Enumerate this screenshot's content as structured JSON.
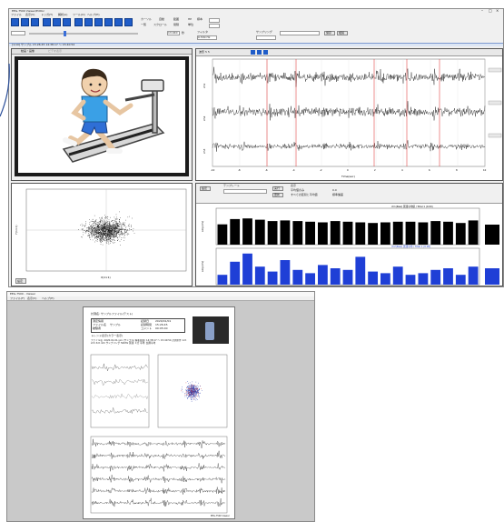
{
  "main_window": {
    "title": "EEG-7500 Viewer/Editor",
    "menu": [
      "ファイル",
      "表示(V)",
      "トリガ(T)",
      "解析(A)",
      "ツール(O)",
      "ヘルプ(H)"
    ],
    "toolbar": {
      "cursor": "カーソル",
      "auto": "自動",
      "range": "範囲",
      "list": "一覧",
      "scroll": "スクロール",
      "interval": "間隔",
      "unit": "単位",
      "filter": "フィルタ",
      "rate": "サンプリング",
      "time_value": "13.040",
      "time_label": "秒",
      "filter_value": "0.530 Hz",
      "hp_label": "HP",
      "sample_label": "標本",
      "save": "保存",
      "copy": "複製"
    },
    "status_strip": "[1/10] サンプル 15:26:45  14:38:17 ～ 15:40:54",
    "video_tab": "動画・画像",
    "video_tab2": "ビデオ表示",
    "scatter_axis_x": "X(1×1)",
    "scatter_axis_y": "Y(1×1)",
    "scatter_footer": "y = 0.0001x\nR² = 0.0000",
    "scatter_button": "設定",
    "wave_header": "波形 5  5",
    "wave_channels": [
      "ch1",
      "ch2",
      "ch3"
    ],
    "wave_time_label": "Time(sec)",
    "wave_time_ticks": [
      "-10",
      "-8",
      "-6",
      "-4",
      "-2",
      "0",
      "2",
      "4",
      "6",
      "8",
      "10"
    ],
    "hist_controls": {
      "template": "テンプレート",
      "setting": "設定",
      "exec": "実行",
      "update": "更新",
      "display": "表示",
      "opt1": "平均値のみ",
      "opt2": "すべての区間と平均値",
      "opt3": "0.0",
      "opt4": "標準偏差"
    },
    "hist_title_top": "ch1(Raw) 区間平均値 / Total 1 (0.00)",
    "hist_title_bottom": "ch2(Raw) 区間平均 / Total 1 (0.00)",
    "hist_ylabel_top": "Amp(mV)",
    "hist_ylabel_bottom": "Amp(mV)"
  },
  "chart_data": [
    {
      "type": "bar",
      "title": "ch1(Raw) 区間平均値 / Total 1 (0.00)",
      "ylabel": "Amp(mV)",
      "values": [
        62,
        78,
        80,
        76,
        72,
        74,
        72,
        70,
        68,
        72,
        70,
        68,
        66,
        68,
        70,
        70,
        68,
        72,
        70,
        66,
        74
      ],
      "color": "#000000"
    },
    {
      "type": "bar",
      "title": "ch2(Raw) 区間平均 / Total 1 (0.00)",
      "ylabel": "Amp(mV)",
      "values": [
        30,
        70,
        95,
        55,
        40,
        75,
        45,
        35,
        60,
        50,
        45,
        85,
        40,
        35,
        55,
        30,
        35,
        45,
        50,
        30,
        55
      ],
      "color": "#1f3fd6"
    }
  ],
  "report_window": {
    "title": "EEG-7500 - Viewer",
    "menu": [
      "ファイル(F)",
      "表示(V)",
      "ヘルプ(H)"
    ],
    "heading": "計測名: サンプルファイル(テスト)",
    "info_labels": [
      "測定情報",
      "ファイル名",
      "記録日",
      "記録時間",
      "被験者",
      "コメント"
    ],
    "info_values": [
      "サンプル",
      "2020/01/01",
      "15:26:45",
      "00:05:00"
    ],
    "section1": "トレンド表示(カラー表示)",
    "desc": "ファイル名: 2020.01.01.xxx (サンプル) 解析範囲: 14:38:17 ～ 15:40:54 計測条件 1ch 2ch 3ch 4ch サンプリング 500Hz  区間: 1分 平均: 加算平均",
    "footer": "EEG-7500 Viewer"
  }
}
